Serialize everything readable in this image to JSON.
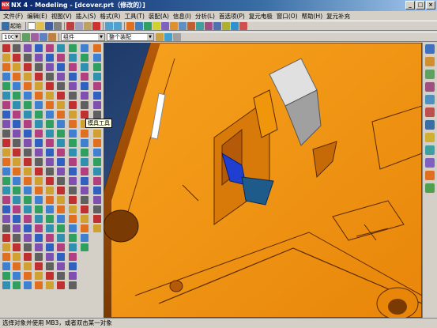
{
  "window": {
    "title": "NX 4 - Modeling - [dcover.prt（修改的）]",
    "logo": "NX"
  },
  "menu": [
    "文件(F)",
    "编辑(E)",
    "视图(V)",
    "插入(S)",
    "格式(R)",
    "工具(T)",
    "装配(A)",
    "信息(I)",
    "分析(L)",
    "首选项(P)",
    "复元电极",
    "窗口(O)",
    "帮助(H)",
    "复元补充"
  ],
  "toolbar": {
    "start_label": "起始",
    "zoom_value": "100",
    "filter_value": "组件",
    "assembly_value": "整个装配"
  },
  "tooltip": "模具工具",
  "statusbar": {
    "text": "选择对象并使用 MB3，或者双击某一对象"
  },
  "colors": {
    "title_bar": "#0a246a",
    "model": "#f0960a",
    "background": "#2d4a7a"
  }
}
